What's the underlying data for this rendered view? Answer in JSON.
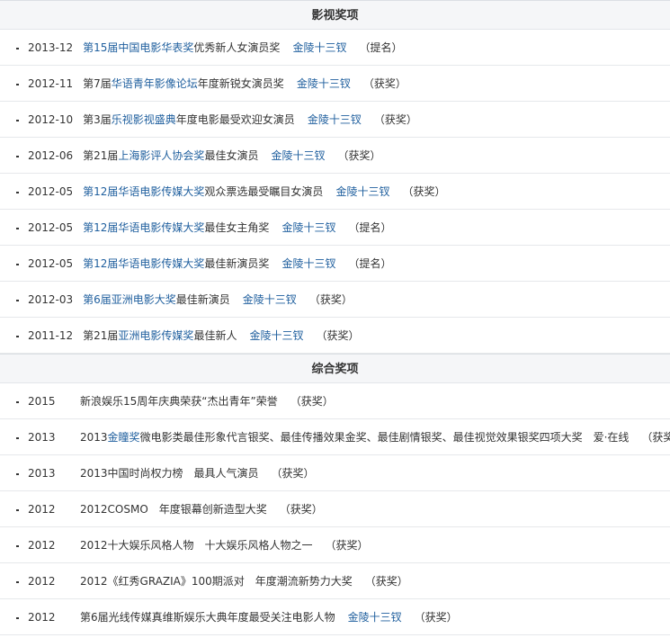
{
  "sections": [
    {
      "title": "影视奖项",
      "rows": [
        {
          "date": "2013-12",
          "segments": [
            {
              "text": "第15届中国电影华表奖",
              "link": true
            },
            {
              "text": "优秀新人女演员奖",
              "link": false
            }
          ],
          "work": "金陵十三钗",
          "result": "（提名）"
        },
        {
          "date": "2012-11",
          "segments": [
            {
              "text": "第7届",
              "link": false
            },
            {
              "text": "华语青年影像论坛",
              "link": true
            },
            {
              "text": "年度新锐女演员奖",
              "link": false
            }
          ],
          "work": "金陵十三钗",
          "result": "（获奖）"
        },
        {
          "date": "2012-10",
          "segments": [
            {
              "text": "第3届",
              "link": false
            },
            {
              "text": "乐视影视盛典",
              "link": true
            },
            {
              "text": "年度电影最受欢迎女演员",
              "link": false
            }
          ],
          "work": "金陵十三钗",
          "result": "（获奖）"
        },
        {
          "date": "2012-06",
          "segments": [
            {
              "text": "第21届",
              "link": false
            },
            {
              "text": "上海影评人协会奖",
              "link": true
            },
            {
              "text": "最佳女演员",
              "link": false
            }
          ],
          "work": "金陵十三钗",
          "result": "（获奖）"
        },
        {
          "date": "2012-05",
          "segments": [
            {
              "text": "第12届华语电影传媒大奖",
              "link": true
            },
            {
              "text": "观众票选最受瞩目女演员",
              "link": false
            }
          ],
          "work": "金陵十三钗",
          "result": "（获奖）"
        },
        {
          "date": "2012-05",
          "segments": [
            {
              "text": "第12届华语电影传媒大奖",
              "link": true
            },
            {
              "text": "最佳女主角奖",
              "link": false
            }
          ],
          "work": "金陵十三钗",
          "result": "（提名）"
        },
        {
          "date": "2012-05",
          "segments": [
            {
              "text": "第12届华语电影传媒大奖",
              "link": true
            },
            {
              "text": "最佳新演员奖",
              "link": false
            }
          ],
          "work": "金陵十三钗",
          "result": "（提名）"
        },
        {
          "date": "2012-03",
          "segments": [
            {
              "text": "第6届亚洲电影大奖",
              "link": true
            },
            {
              "text": "最佳新演员",
              "link": false
            }
          ],
          "work": "金陵十三钗",
          "result": "（获奖）"
        },
        {
          "date": "2011-12",
          "segments": [
            {
              "text": "第21届",
              "link": false
            },
            {
              "text": "亚洲电影传媒奖",
              "link": true
            },
            {
              "text": "最佳新人",
              "link": false
            }
          ],
          "work": "金陵十三钗",
          "result": "（获奖）"
        }
      ]
    },
    {
      "title": "综合奖项",
      "rows": [
        {
          "date": "2015",
          "segments": [
            {
              "text": "新浪娱乐15周年庆典荣获“杰出青年”荣誉",
              "link": false
            }
          ],
          "work": "",
          "result": "（获奖）"
        },
        {
          "date": "2013",
          "segments": [
            {
              "text": "2013",
              "link": false
            },
            {
              "text": "金瞳奖",
              "link": true
            },
            {
              "text": "微电影类最佳形象代言银奖、最佳传播效果金奖、最佳剧情银奖、最佳视觉效果银奖四项大奖　爱·在线",
              "link": false
            }
          ],
          "work": "",
          "result": "（获奖）"
        },
        {
          "date": "2013",
          "segments": [
            {
              "text": "2013中国时尚权力榜　最具人气演员",
              "link": false
            }
          ],
          "work": "",
          "result": "（获奖）"
        },
        {
          "date": "2012",
          "segments": [
            {
              "text": "2012COSMO　年度银幕创新造型大奖",
              "link": false
            }
          ],
          "work": "",
          "result": "（获奖）"
        },
        {
          "date": "2012",
          "segments": [
            {
              "text": "2012十大娱乐风格人物　十大娱乐风格人物之一",
              "link": false
            }
          ],
          "work": "",
          "result": "（获奖）"
        },
        {
          "date": "2012",
          "segments": [
            {
              "text": "2012《红秀GRAZIA》100期派对　年度潮流新势力大奖",
              "link": false
            }
          ],
          "work": "",
          "result": "（获奖）"
        },
        {
          "date": "2012",
          "segments": [
            {
              "text": "第6届光线传媒真维斯娱乐大典年度最受关注电影人物",
              "link": false
            }
          ],
          "work": "金陵十三钗",
          "result": "（获奖）"
        }
      ]
    }
  ]
}
